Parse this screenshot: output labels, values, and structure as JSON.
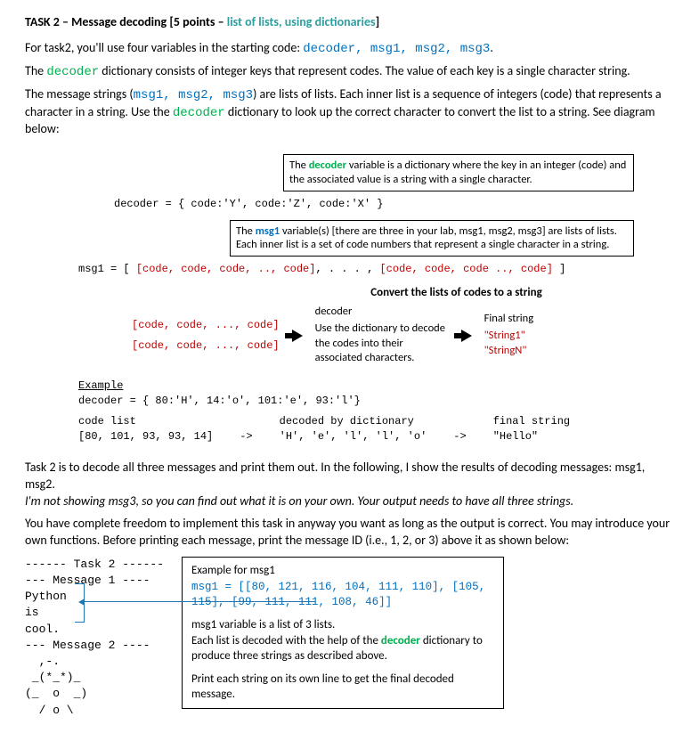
{
  "title": {
    "pre": "TASK 2 – Message decoding [5 points – ",
    "mid": "list of lists, using dictionaries",
    "post": "]"
  },
  "intro": {
    "p1a": "For task2, you'll use four variables in the starting code: ",
    "p1vars": "decoder, msg1, msg2, msg3",
    "p1b": ".",
    "p2a": "The ",
    "p2dec": "decoder",
    "p2b": " dictionary consists of integer keys that represent codes.  The value of each key is a single character string.",
    "p3a": "The message strings (",
    "p3vars": "msg1, msg2, msg3",
    "p3b": ") are lists of lists.  Each inner list is a sequence of integers (code) that represents a character in a string.  Use the ",
    "p3dec": "decoder",
    "p3c": "  dictionary to look up the correct character to convert the list to a string.  See diagram below:"
  },
  "diagram": {
    "callout1a": "The ",
    "callout1dec": "decoder",
    "callout1b": " variable is a dictionary where the key in an integer (code) and the associated value is a string with a single character.",
    "decoder_line": "decoder = { code:'Y', code:'Z', code:'X' }",
    "callout2a": "The ",
    "callout2msg": "msg1",
    "callout2b": " variable(s) [there are three in your lab, msg1, msg2, msg3] are lists of lists.  Each inner list is a set of code numbers that represent a single character in a string.",
    "msg_pre": "msg1 = [  ",
    "msg_list1": "[code, code, code, .., code]",
    "msg_mid": ",  . . . ,  ",
    "msg_list2": "[code, code, code .., code]",
    "msg_end": "  ]",
    "convert_title": "Convert the lists of codes to a string",
    "left_item": "[code, code, ..., code]",
    "head_dec": "decoder",
    "dec_desc": "Use the dictionary to decode the codes into their associated characters.",
    "head_final": "Final string",
    "str1": "\"String1\"",
    "strn": "\"StringN\"",
    "ex_hdr": "Example",
    "ex_dec": "decoder = { 80:'H', 14:'o', 101:'e', 93:'l'}",
    "ex_h1": "code list",
    "ex_v1": "[80, 101, 93, 93, 14]",
    "ex_h2": "decoded by dictionary",
    "ex_v2": "'H', 'e', 'l', 'l', 'o'",
    "ex_h3": "final string",
    "ex_v3": "\"Hello\"",
    "arrow": "->"
  },
  "mid": {
    "p4": "Task 2 is to decode all three messages and print them out.  In the following, I show the results of decoding messages: msg1, msg2.",
    "p4i": "I'm not showing msg3, so you can find out what it is on your own. Your output needs to have all three strings.",
    "p5": "You have complete freedom to implement this task in anyway you want as long as the output is correct.   You may introduce your own functions.   Before printing each message, print the message ID (i.e., 1, 2, or 3) above it as shown below:"
  },
  "output": {
    "left": "------ Task 2 ------\n--- Message 1 ----\nPython\nis\ncool.\n--- Message 2 ----\n  ,-.\n _(*_*)_\n(_  o  _)\n  / o \\",
    "right_t": "Example for msg1",
    "right_code": "msg1 = [[80, 121, 116, 104, 111, 110], [105, 115], [99, 111, 111, 108, 46]]",
    "right_l1": "msg1  variable is a list of 3 lists.",
    "right_l2a": "Each list is decoded with the help of the ",
    "right_l2dec": "decoder",
    "right_l2b": " dictionary to produce three strings as described above.",
    "right_l3": "Print each string on its own line to get the final decoded message."
  }
}
